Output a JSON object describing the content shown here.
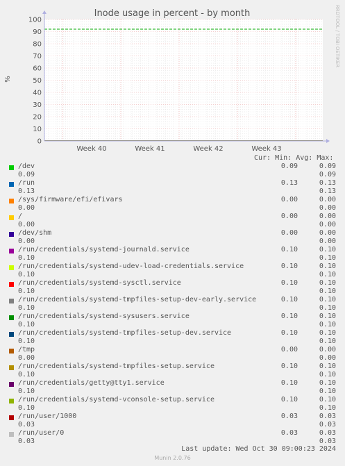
{
  "chart_data": {
    "type": "line",
    "title": "Inode usage in percent - by month",
    "ylabel": "%",
    "xlabel": "",
    "ylim": [
      0,
      100
    ],
    "yticks": [
      0,
      10,
      20,
      30,
      40,
      50,
      60,
      70,
      80,
      90,
      100
    ],
    "xticks": [
      "Week 40",
      "Week 41",
      "Week 42",
      "Week 43"
    ],
    "grid": true,
    "side_label": "RRDTOOL / TOBI OETIKER",
    "warning_line": 92,
    "colors": {
      "warning": "#00aa00",
      "grid_major": "#e8a0a0",
      "grid_minor": "#dddddd",
      "axis": "#b0b0e0",
      "plot_bg": "#ffffff"
    }
  },
  "legend": {
    "headers": {
      "cur": "Cur:",
      "min": "Min:",
      "avg": "Avg:",
      "max": "Max:"
    },
    "items": [
      {
        "name": "/dev",
        "color": "#00cc00",
        "cur": "0.09",
        "min": "0.09",
        "avg": "0.09",
        "max": "0.09"
      },
      {
        "name": "/run",
        "color": "#0066b3",
        "cur": "0.13",
        "min": "0.13",
        "avg": "0.13",
        "max": "0.13"
      },
      {
        "name": "/sys/firmware/efi/efivars",
        "color": "#ff8000",
        "cur": "0.00",
        "min": "0.00",
        "avg": "0.00",
        "max": "0.00"
      },
      {
        "name": "/",
        "color": "#ffcc00",
        "cur": "0.00",
        "min": "0.00",
        "avg": "0.00",
        "max": "0.00"
      },
      {
        "name": "/dev/shm",
        "color": "#330099",
        "cur": "0.00",
        "min": "0.00",
        "avg": "0.00",
        "max": "0.00"
      },
      {
        "name": "/run/credentials/systemd-journald.service",
        "color": "#990099",
        "cur": "0.10",
        "min": "0.10",
        "avg": "0.10",
        "max": "0.10"
      },
      {
        "name": "/run/credentials/systemd-udev-load-credentials.service",
        "color": "#ccff00",
        "cur": "0.10",
        "min": "0.10",
        "avg": "0.10",
        "max": "0.10"
      },
      {
        "name": "/run/credentials/systemd-sysctl.service",
        "color": "#ff0000",
        "cur": "0.10",
        "min": "0.10",
        "avg": "0.10",
        "max": "0.10"
      },
      {
        "name": "/run/credentials/systemd-tmpfiles-setup-dev-early.service",
        "color": "#808080",
        "cur": "0.10",
        "min": "0.10",
        "avg": "0.10",
        "max": "0.10"
      },
      {
        "name": "/run/credentials/systemd-sysusers.service",
        "color": "#008f00",
        "cur": "0.10",
        "min": "0.10",
        "avg": "0.10",
        "max": "0.10"
      },
      {
        "name": "/run/credentials/systemd-tmpfiles-setup-dev.service",
        "color": "#00487d",
        "cur": "0.10",
        "min": "0.10",
        "avg": "0.10",
        "max": "0.10"
      },
      {
        "name": "/tmp",
        "color": "#b35a00",
        "cur": "0.00",
        "min": "0.00",
        "avg": "0.00",
        "max": "0.00"
      },
      {
        "name": "/run/credentials/systemd-tmpfiles-setup.service",
        "color": "#b38f00",
        "cur": "0.10",
        "min": "0.10",
        "avg": "0.10",
        "max": "0.10"
      },
      {
        "name": "/run/credentials/getty@tty1.service",
        "color": "#6b006b",
        "cur": "0.10",
        "min": "0.10",
        "avg": "0.10",
        "max": "0.10"
      },
      {
        "name": "/run/credentials/systemd-vconsole-setup.service",
        "color": "#8fb300",
        "cur": "0.10",
        "min": "0.10",
        "avg": "0.10",
        "max": "0.10"
      },
      {
        "name": "/run/user/1000",
        "color": "#b30000",
        "cur": "0.03",
        "min": "0.03",
        "avg": "0.03",
        "max": "0.03"
      },
      {
        "name": "/run/user/0",
        "color": "#bebebe",
        "cur": "0.03",
        "min": "0.03",
        "avg": "0.03",
        "max": "0.03"
      }
    ]
  },
  "footer": {
    "last_update": "Last update: Wed Oct 30 09:00:23 2024",
    "munin_version": "Munin 2.0.76"
  }
}
